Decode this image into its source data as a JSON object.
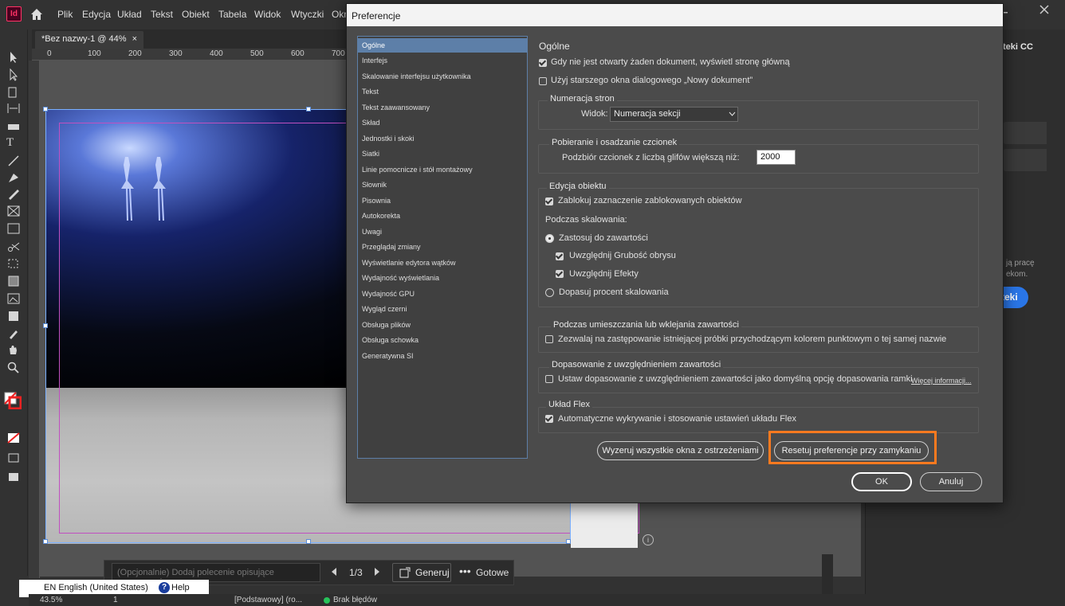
{
  "menubar": {
    "logo": "Id",
    "items": [
      "Plik",
      "Edycja",
      "Układ",
      "Tekst",
      "Obiekt",
      "Tabela",
      "Widok",
      "Wtyczki",
      "Okn"
    ]
  },
  "document_tab": {
    "label": "*Bez nazwy-1 @ 44%",
    "close": "×"
  },
  "ruler_top": [
    "0",
    "100",
    "200",
    "300",
    "400",
    "500",
    "600",
    "700"
  ],
  "right_panel": {
    "title": "teki CC",
    "text1": "ją pracę",
    "text2": "ekom.",
    "button": "teki"
  },
  "generative_bar": {
    "input_placeholder": "(Opcjonalnie) Dodaj polecenie opisujące rozszerzenie",
    "page": "1/3",
    "generate_label": "Generuj",
    "done_label": "Gotowe"
  },
  "language_bar": {
    "language": "EN English (United States)",
    "help": "Help"
  },
  "statusbar": {
    "zoom": "43.5%",
    "page": "1",
    "style": "[Podstawowy] (ro...",
    "preflight": "Brak błędów"
  },
  "dialog": {
    "title": "Preferencje",
    "nav": [
      "Ogólne",
      "Interfejs",
      "Skalowanie interfejsu użytkownika",
      "Tekst",
      "Tekst zaawansowany",
      "Skład",
      "Jednostki i skoki",
      "Siatki",
      "Linie pomocnicze i stół montażowy",
      "Słownik",
      "Pisownia",
      "Autokorekta",
      "Uwagi",
      "Przeglądaj zmiany",
      "Wyświetlanie edytora wątków",
      "Wydajność wyświetlania",
      "Wydajność GPU",
      "Wygląd czerni",
      "Obsługa plików",
      "Obsługa schowka",
      "Generatywna SI"
    ],
    "selected_nav": 0,
    "section_title": "Ogólne",
    "opt_home": "Gdy nie jest otwarty żaden dokument, wyświetl stronę główną",
    "opt_legacy_new": "Użyj starszego okna dialogowego „Nowy dokument”",
    "page_numbering": {
      "title": "Numeracja stron",
      "view_label": "Widok:",
      "view_value": "Numeracja sekcji"
    },
    "font_download": {
      "title": "Pobieranie i osadzanie czcionek",
      "subset_label": "Podzbiór czcionek z liczbą glifów większą niż:",
      "subset_value": "2000"
    },
    "object_editing": {
      "title": "Edycja obiektu",
      "lock_selection": "Zablokuj zaznaczenie zablokowanych obiektów",
      "when_scaling": "Podczas skalowania:",
      "apply_to_content": "Zastosuj do zawartości",
      "include_stroke": "Uwzględnij Grubość obrysu",
      "include_effects": "Uwzględnij Efekty",
      "adjust_percent": "Dopasuj procent skalowania"
    },
    "placing": {
      "title": "Podczas umieszczania lub wklejania zawartości",
      "allow_replace": "Zezwalaj na zastępowanie istniejącej próbki przychodzącym kolorem punktowym o tej samej nazwie"
    },
    "content_aware": {
      "title": "Dopasowanie z uwzględnieniem zawartości",
      "set_default": "Ustaw dopasowanie z uwzględnieniem zawartości jako domyślną opcję dopasowania ramki",
      "more_info": "Więcej informacji..."
    },
    "flex": {
      "title": "Układ Flex",
      "auto_detect": "Automatyczne wykrywanie i stosowanie ustawień układu Flex"
    },
    "reset_warnings": "Wyzeruj wszystkie okna z ostrzeżeniami",
    "reset_prefs": "Resetuj preferencje przy zamykaniu",
    "ok": "OK",
    "cancel": "Anuluj"
  },
  "colors": {
    "accent": "#5d7fa8",
    "highlight": "#ff7a1f",
    "brand": "#ff3366",
    "primary_button": "#2a76e7"
  }
}
